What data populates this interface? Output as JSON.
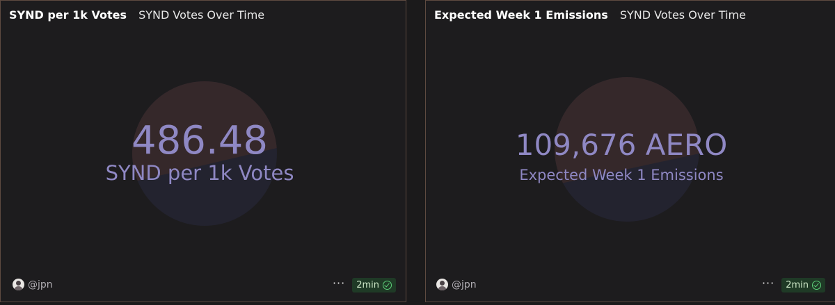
{
  "panels": [
    {
      "title": "SYND per 1k Votes",
      "tab": "SYND Votes Over Time",
      "value": "486.48",
      "label": "SYND per 1k Votes",
      "user": "@jpn",
      "refresh": "2min"
    },
    {
      "title": "Expected Week 1 Emissions",
      "tab": "SYND Votes Over Time",
      "value": "109,676 AERO",
      "label": "Expected Week 1 Emissions",
      "user": "@jpn",
      "refresh": "2min"
    }
  ],
  "icons": {
    "more": "ellipsis-icon",
    "status": "check-circle-icon",
    "avatar": "user-avatar"
  },
  "colors": {
    "background": "#1d1c1e",
    "value_text": "#8f88c4",
    "pie_top": "#35282a",
    "pie_bottom": "#23232f",
    "badge_bg": "#1f3a26",
    "badge_icon": "#5ed17a"
  }
}
